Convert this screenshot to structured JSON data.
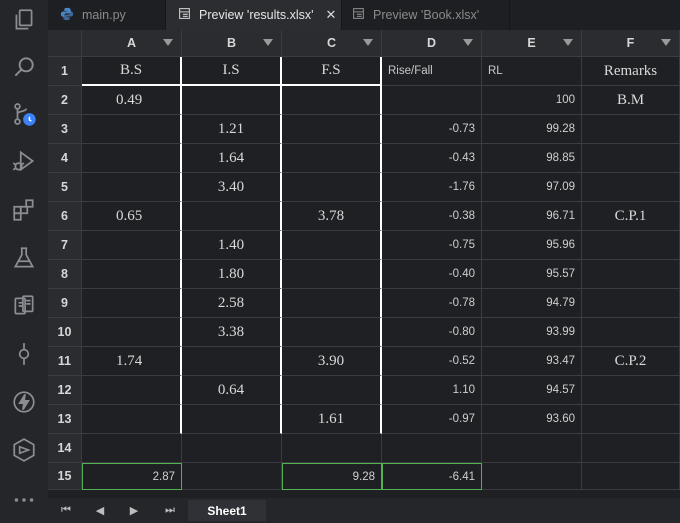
{
  "tabs": [
    {
      "label": "main.py",
      "icon": "python-icon",
      "active": false
    },
    {
      "label": "Preview 'results.xlsx'",
      "icon": "preview-icon",
      "active": true,
      "close": "✕"
    },
    {
      "label": "Preview 'Book.xlsx'",
      "icon": "preview-icon",
      "active": false
    }
  ],
  "activity_icons": [
    "files-icon",
    "search-icon",
    "source-control-icon",
    "run-debug-icon",
    "extensions-icon",
    "flask-icon",
    "remote-icon",
    "git-commit-icon",
    "lightning-icon",
    "cube-icon",
    "more-icon"
  ],
  "spreadsheet": {
    "columns": [
      "A",
      "B",
      "C",
      "D",
      "E",
      "F"
    ],
    "rows": [
      {
        "n": "1",
        "a": "B.S",
        "b": "I.S",
        "c": "F.S",
        "d": "Rise/Fall",
        "e": "RL",
        "f": "Remarks"
      },
      {
        "n": "2",
        "a": "0.49",
        "b": "",
        "c": "",
        "d": "",
        "e": "100",
        "f": "B.M"
      },
      {
        "n": "3",
        "a": "",
        "b": "1.21",
        "c": "",
        "d": "-0.73",
        "e": "99.28",
        "f": ""
      },
      {
        "n": "4",
        "a": "",
        "b": "1.64",
        "c": "",
        "d": "-0.43",
        "e": "98.85",
        "f": ""
      },
      {
        "n": "5",
        "a": "",
        "b": "3.40",
        "c": "",
        "d": "-1.76",
        "e": "97.09",
        "f": ""
      },
      {
        "n": "6",
        "a": "0.65",
        "b": "",
        "c": "3.78",
        "d": "-0.38",
        "e": "96.71",
        "f": "C.P.1"
      },
      {
        "n": "7",
        "a": "",
        "b": "1.40",
        "c": "",
        "d": "-0.75",
        "e": "95.96",
        "f": ""
      },
      {
        "n": "8",
        "a": "",
        "b": "1.80",
        "c": "",
        "d": "-0.40",
        "e": "95.57",
        "f": ""
      },
      {
        "n": "9",
        "a": "",
        "b": "2.58",
        "c": "",
        "d": "-0.78",
        "e": "94.79",
        "f": ""
      },
      {
        "n": "10",
        "a": "",
        "b": "3.38",
        "c": "",
        "d": "-0.80",
        "e": "93.99",
        "f": ""
      },
      {
        "n": "11",
        "a": "1.74",
        "b": "",
        "c": "3.90",
        "d": "-0.52",
        "e": "93.47",
        "f": "C.P.2"
      },
      {
        "n": "12",
        "a": "",
        "b": "0.64",
        "c": "",
        "d": "1.10",
        "e": "94.57",
        "f": ""
      },
      {
        "n": "13",
        "a": "",
        "b": "",
        "c": "1.61",
        "d": "-0.97",
        "e": "93.60",
        "f": ""
      },
      {
        "n": "14",
        "a": "",
        "b": "",
        "c": "",
        "d": "",
        "e": "",
        "f": ""
      },
      {
        "n": "15",
        "a": "2.87",
        "b": "",
        "c": "9.28",
        "d": "-6.41",
        "e": "",
        "f": ""
      }
    ]
  },
  "sheet_nav": {
    "first": "⏮",
    "prev": "◀",
    "next": "▶",
    "last": "⏭"
  },
  "sheet_tab": "Sheet1",
  "colors": {
    "accent_green": "#55b054",
    "background": "#1f2023",
    "header": "#2a2c30"
  }
}
